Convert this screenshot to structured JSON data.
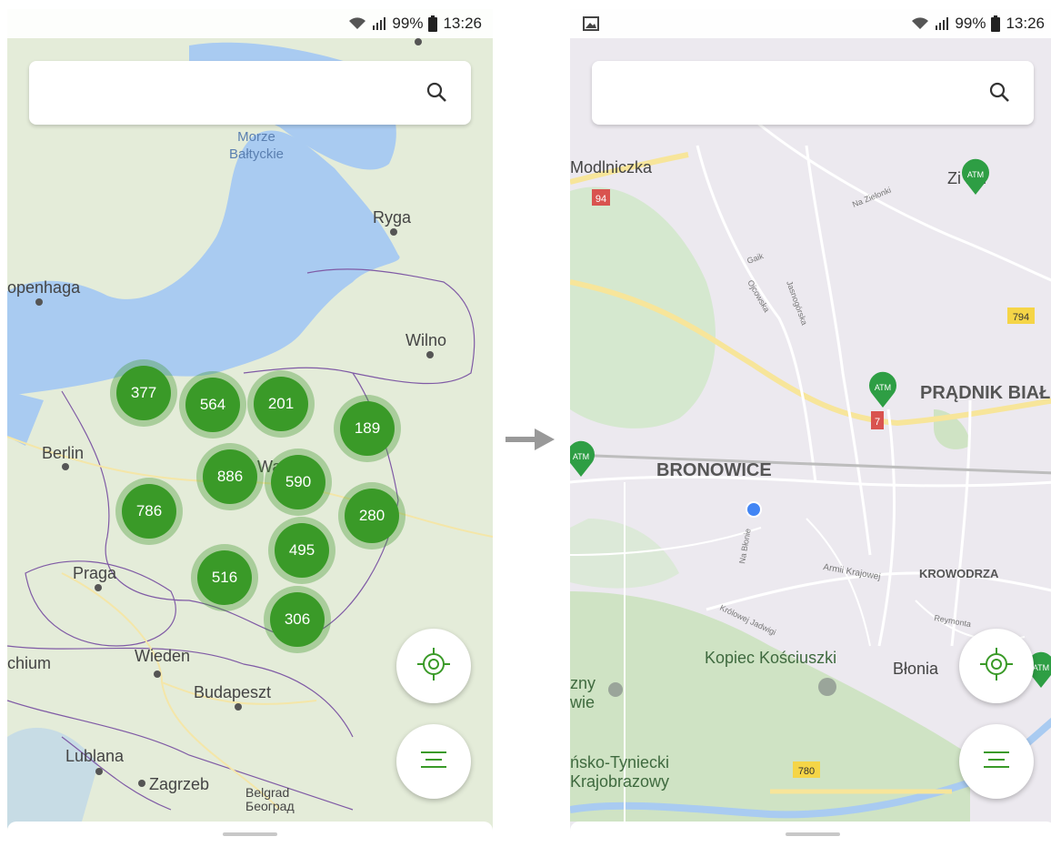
{
  "status_bar": {
    "battery": "99%",
    "time": "13:26"
  },
  "search": {
    "placeholder": ""
  },
  "left_map": {
    "labels": {
      "sea": "Morze\nBałtyckie",
      "sea_line1": "Morze",
      "sea_line2": "Bałtyckie",
      "ryga": "Ryga",
      "kopenhaga": "openhaga",
      "wilno": "Wilno",
      "berlin": "Berlin",
      "warszawa": "Wa      wa",
      "praga": "Praga",
      "wieden": "Wieden",
      "chium": "chium",
      "budapeszt": "Budapeszt",
      "lublana": "Lublana",
      "zagrzeb": "Zagrzeb",
      "belgrad": "Belgrad",
      "beograd": "Београд"
    },
    "clusters": [
      "377",
      "564",
      "201",
      "189",
      "886",
      "590",
      "786",
      "280",
      "495",
      "516",
      "306"
    ]
  },
  "right_map": {
    "labels": {
      "modlniczka": "Modlniczka",
      "zielonki": "Zi      nki",
      "na_zielonki": "Na Zielonki",
      "gaik": "Gaik",
      "ojcowska": "Ojcowska",
      "jasnogorska": "Jasnogórska",
      "pradnik": "PRĄDNIK BIAŁ",
      "bronowice": "BRONOWICE",
      "na_blonie": "Na Błonie",
      "armii": "Armii Krajowej",
      "krowodrza": "KROWODRZA",
      "krolowej": "Królowej Jadwigi",
      "reymonta": "Reymonta",
      "kopiec": "Kopiec Kościuszki",
      "blonia": "Błonia",
      "zny": "zny",
      "wie": "wie",
      "tyniecki": "ńsko-Tyniecki",
      "krajobrazowy": "Krajobrazowy"
    },
    "road_signs": {
      "r94": "94",
      "r7": "7",
      "r794": "794",
      "r780": "780"
    },
    "atm_label": "ATM"
  },
  "colors": {
    "cluster_green": "#3a9a28",
    "atm_green": "#2e9e44",
    "water": "#a9cbf1",
    "land": "#e8eedf"
  }
}
